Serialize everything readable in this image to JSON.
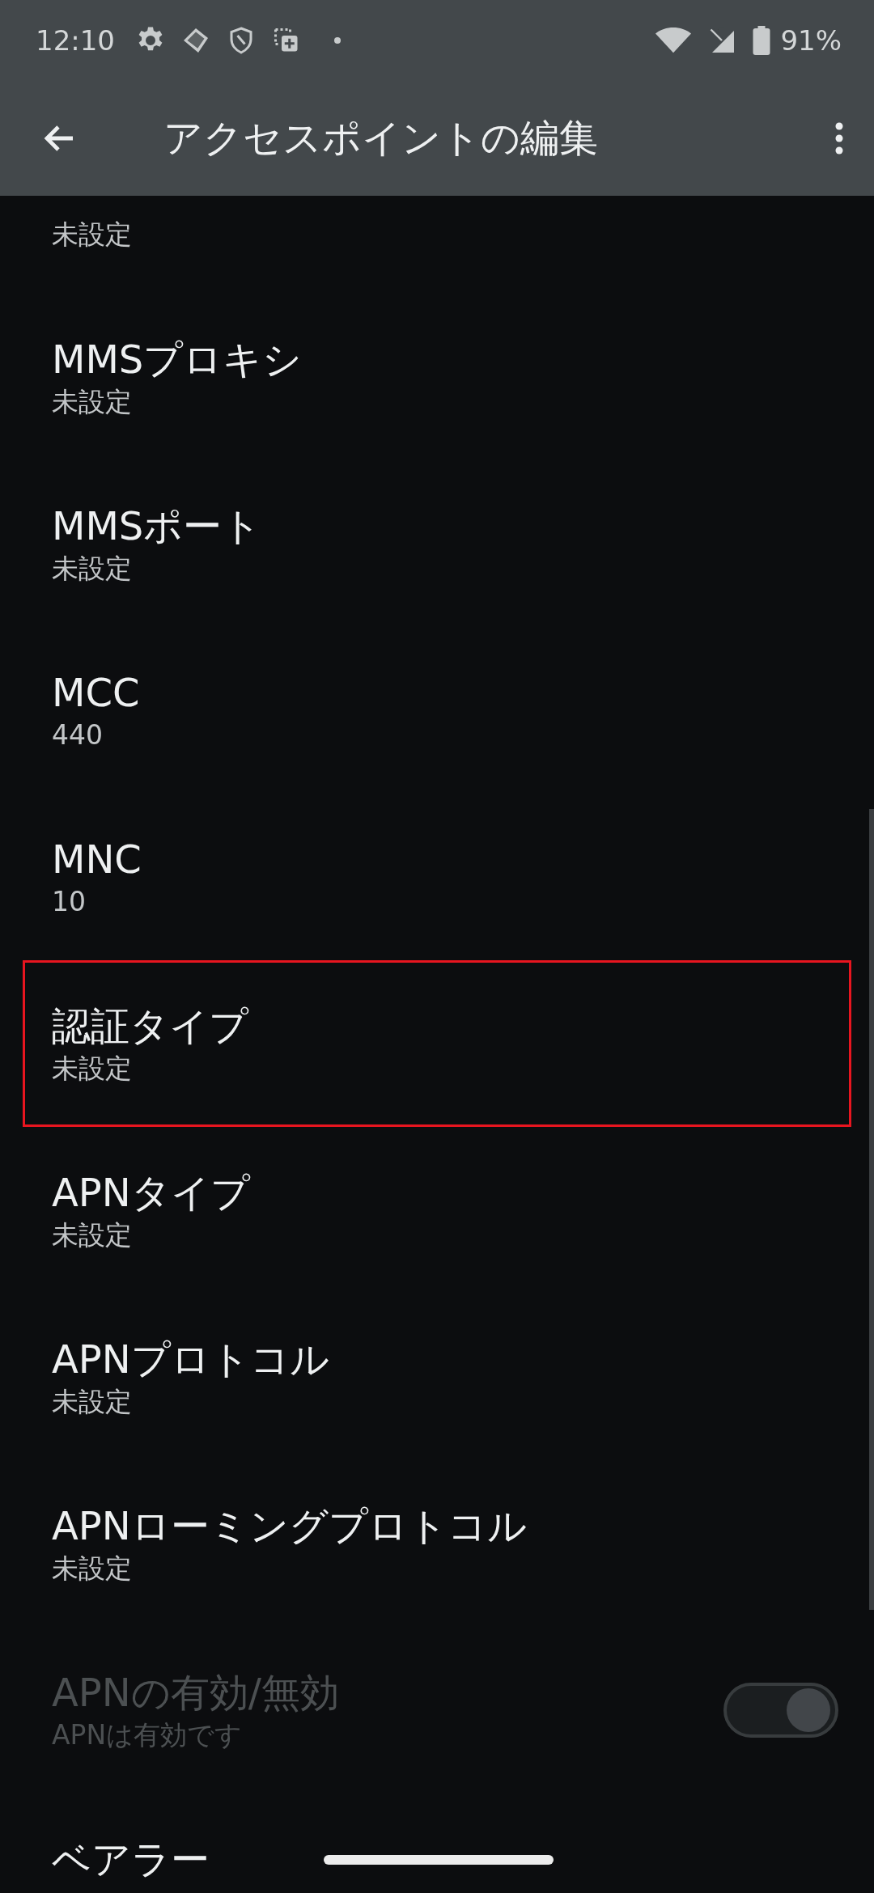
{
  "status_bar": {
    "time": "12:10",
    "battery": "91%"
  },
  "app_bar": {
    "title": "アクセスポイントの編集"
  },
  "settings": [
    {
      "kind": "text",
      "summary": "未設定",
      "highlighted": false,
      "disabled": false
    },
    {
      "kind": "text",
      "title": "MMSプロキシ",
      "summary": "未設定",
      "highlighted": false,
      "disabled": false
    },
    {
      "kind": "text",
      "title": "MMSポート",
      "summary": "未設定",
      "highlighted": false,
      "disabled": false
    },
    {
      "kind": "text",
      "title": "MCC",
      "summary": "440",
      "highlighted": false,
      "disabled": false
    },
    {
      "kind": "text",
      "title": "MNC",
      "summary": "10",
      "highlighted": false,
      "disabled": false
    },
    {
      "kind": "text",
      "title": "認証タイプ",
      "summary": "未設定",
      "highlighted": true,
      "disabled": false
    },
    {
      "kind": "text",
      "title": "APNタイプ",
      "summary": "未設定",
      "highlighted": false,
      "disabled": false
    },
    {
      "kind": "text",
      "title": "APNプロトコル",
      "summary": "未設定",
      "highlighted": false,
      "disabled": false
    },
    {
      "kind": "text",
      "title": "APNローミングプロトコル",
      "summary": "未設定",
      "highlighted": false,
      "disabled": false
    },
    {
      "kind": "switch",
      "title": "APNの有効/無効",
      "summary": "APNは有効です",
      "highlighted": false,
      "disabled": true,
      "on": true
    },
    {
      "kind": "text",
      "title": "ベアラー",
      "highlighted": false,
      "disabled": false
    }
  ]
}
